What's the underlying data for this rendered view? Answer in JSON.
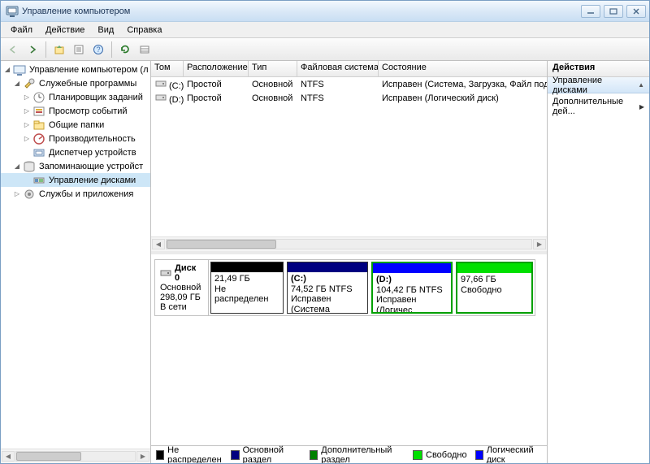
{
  "window": {
    "title": "Управление компьютером"
  },
  "menus": {
    "file": "Файл",
    "action": "Действие",
    "view": "Вид",
    "help": "Справка"
  },
  "tree": {
    "root": "Управление компьютером (л",
    "system_tools": "Служебные программы",
    "task_scheduler": "Планировщик заданий",
    "event_viewer": "Просмотр событий",
    "shared_folders": "Общие папки",
    "performance": "Производительность",
    "device_manager": "Диспетчер устройств",
    "storage": "Запоминающие устройст",
    "disk_management": "Управление дисками",
    "services_apps": "Службы и приложения"
  },
  "vol_headers": {
    "volume": "Том",
    "layout": "Расположение",
    "type": "Тип",
    "fs": "Файловая система",
    "status": "Состояние"
  },
  "volumes": [
    {
      "name": "(C:)",
      "layout": "Простой",
      "type": "Основной",
      "fs": "NTFS",
      "status": "Исправен (Система, Загрузка, Файл подкачки, А"
    },
    {
      "name": "(D:)",
      "layout": "Простой",
      "type": "Основной",
      "fs": "NTFS",
      "status": "Исправен (Логический диск)"
    }
  ],
  "disk": {
    "name": "Диск 0",
    "type": "Основной",
    "size": "298,09 ГБ",
    "status": "В сети"
  },
  "partitions": [
    {
      "label": "",
      "size_fs": "21,49 ГБ",
      "status": "Не распределен",
      "head_color": "#000000",
      "border": "plain",
      "width": 90
    },
    {
      "label": "(C:)",
      "size_fs": "74,52 ГБ NTFS",
      "status": "Исправен (Система",
      "head_color": "#000080",
      "border": "plain",
      "width": 100
    },
    {
      "label": "(D:)",
      "size_fs": "104,42 ГБ NTFS",
      "status": "Исправен (Логичес",
      "head_color": "#0000ff",
      "border": "green",
      "width": 100
    },
    {
      "label": "",
      "size_fs": "97,66 ГБ",
      "status": "Свободно",
      "head_color": "#00e000",
      "border": "green",
      "width": 95
    }
  ],
  "legend": {
    "unallocated": "Не распределен",
    "primary": "Основной раздел",
    "extended": "Дополнительный раздел",
    "free": "Свободно",
    "logical": "Логический диск"
  },
  "legend_colors": {
    "unallocated": "#000000",
    "primary": "#000080",
    "extended": "#008000",
    "free": "#00e000",
    "logical": "#0000ff"
  },
  "actions": {
    "header": "Действия",
    "group": "Управление дисками",
    "more": "Дополнительные дей..."
  }
}
